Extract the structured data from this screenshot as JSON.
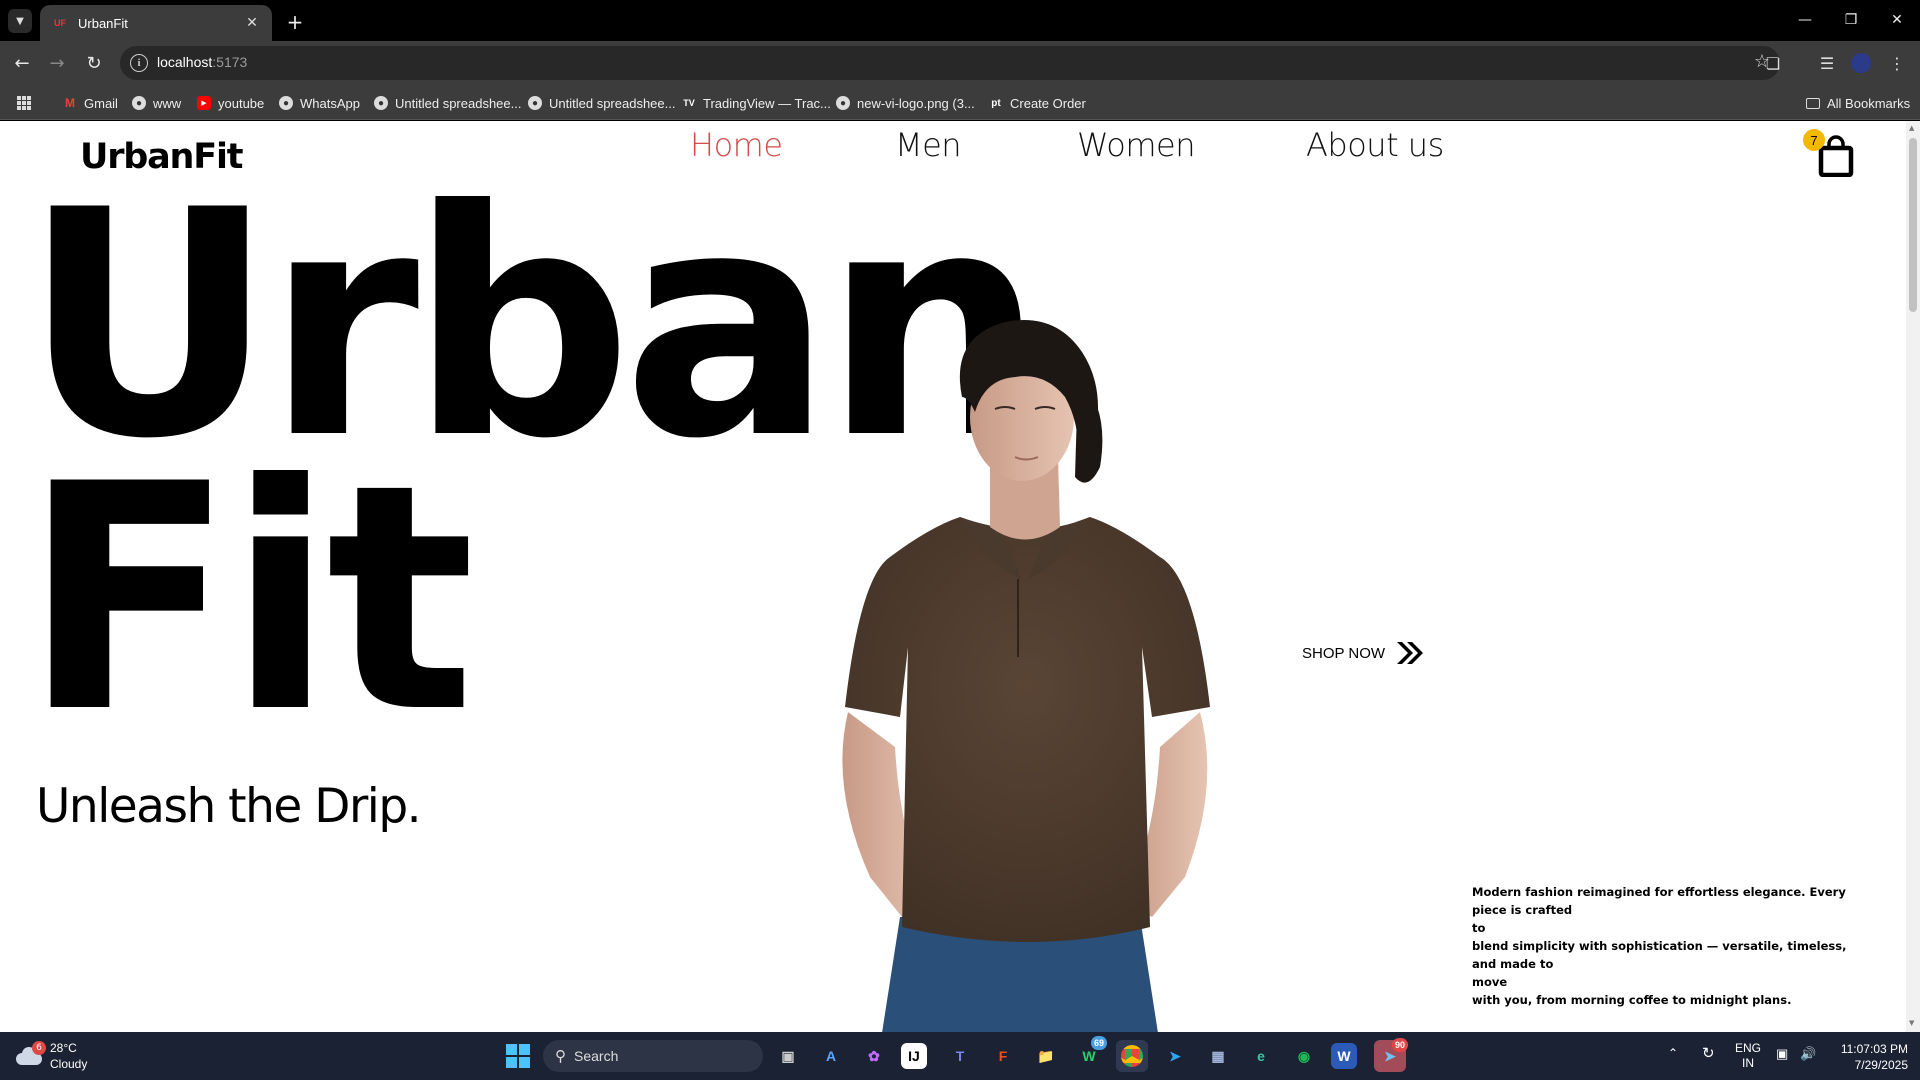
{
  "browser": {
    "tab_title": "UrbanFit",
    "tab_favicon_text": "UF",
    "url_host": "localhost",
    "url_port": ":5173",
    "bookmarks": [
      "Gmail",
      "www",
      "youtube",
      "WhatsApp",
      "Untitled spreadshee...",
      "Untitled spreadshee...",
      "TradingView — Trac...",
      "new-vi-logo.png (3...",
      "Create Order"
    ],
    "all_bookmarks": "All Bookmarks"
  },
  "site": {
    "brand": "UrbanFit",
    "nav": [
      "Home",
      "Men",
      "Women",
      "About us"
    ],
    "active_nav": "Home",
    "cart_count": "7",
    "hero_line1": "Urban",
    "hero_line2": "Fit",
    "tagline": "Unleash the Drip.",
    "shop_now": "SHOP NOW",
    "description": [
      "Modern fashion reimagined for effortless elegance. Every piece is crafted",
      "to",
      "blend simplicity with sophistication — versatile, timeless, and made to",
      "move",
      "with you, from morning coffee to midnight plans."
    ],
    "accent_color": "#d14b4b",
    "badge_color": "#f5b800"
  },
  "taskbar": {
    "weather_temp": "28°C",
    "weather_text": "Cloudy",
    "weather_badge": "6",
    "search_label": "Search",
    "whatsapp_badge": "69",
    "telegram_badge": "90",
    "lang_1": "ENG",
    "lang_2": "IN",
    "time": "11:07:03 PM",
    "date": "7/29/2025"
  }
}
